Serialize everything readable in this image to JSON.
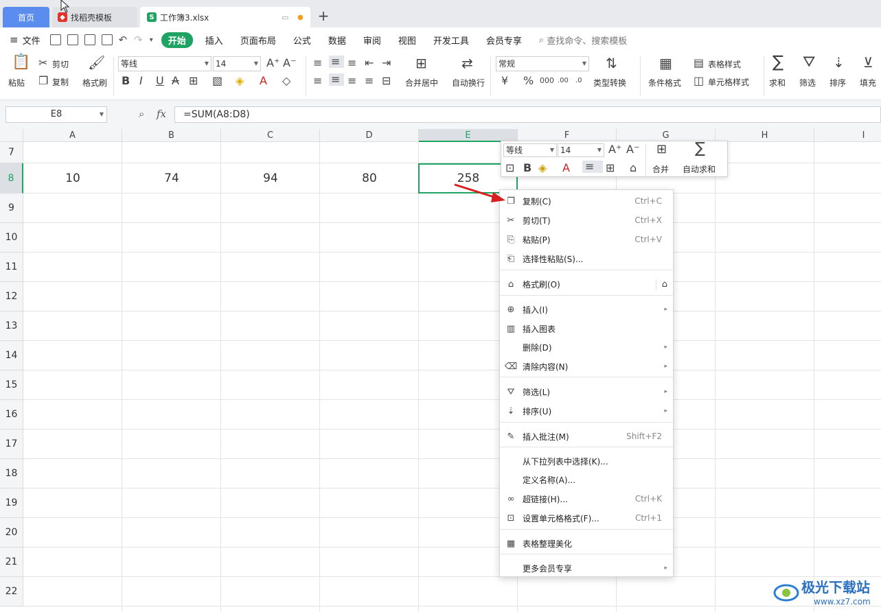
{
  "tabs": {
    "home": "首页",
    "template": "找稻壳模板",
    "workbook": "工作簿3.xlsx"
  },
  "menu": {
    "file": "文件",
    "start": "开始",
    "items": [
      "插入",
      "页面布局",
      "公式",
      "数据",
      "审阅",
      "视图",
      "开发工具",
      "会员专享"
    ],
    "search_placeholder": "查找命令、搜索模板"
  },
  "ribbon": {
    "paste": "粘贴",
    "cut": "剪切",
    "copy": "复制",
    "format_painter": "格式刷",
    "font_name": "等线",
    "font_size": "14",
    "merge_center": "合并居中",
    "wrap_text": "自动换行",
    "number_format": "常规",
    "type_convert": "类型转换",
    "conditional_format": "条件格式",
    "table_style": "表格样式",
    "cell_style": "单元格样式",
    "sum": "求和",
    "filter": "筛选",
    "sort": "排序",
    "fill": "填充"
  },
  "formula_bar": {
    "name_box": "E8",
    "fx": "fx",
    "formula": "=SUM(A8:D8)"
  },
  "grid": {
    "columns": [
      "A",
      "B",
      "C",
      "D",
      "E",
      "F",
      "G",
      "H",
      "I"
    ],
    "rows": [
      "7",
      "8",
      "9",
      "10",
      "11",
      "12",
      "13",
      "14",
      "15",
      "16",
      "17",
      "18",
      "19",
      "20",
      "21",
      "22"
    ],
    "row8": [
      "10",
      "74",
      "94",
      "80",
      "258"
    ],
    "selected_cell": "E8"
  },
  "mini_toolbar": {
    "font_name": "等线",
    "font_size": "14",
    "merge": "合并",
    "autosum": "自动求和"
  },
  "context_menu": {
    "items": [
      {
        "label": "复制(C)",
        "shortcut": "Ctrl+C",
        "icon": "copy-icon"
      },
      {
        "label": "剪切(T)",
        "shortcut": "Ctrl+X",
        "icon": "scissors-icon"
      },
      {
        "label": "粘贴(P)",
        "shortcut": "Ctrl+V",
        "icon": "paste-icon"
      },
      {
        "label": "选择性粘贴(S)...",
        "shortcut": "",
        "icon": "paste-special-icon"
      },
      {
        "label": "格式刷(O)",
        "shortcut": "",
        "icon": "format-painter-icon"
      },
      {
        "label": "插入(I)",
        "shortcut": "",
        "icon": "insert-icon"
      },
      {
        "label": "插入图表",
        "shortcut": "",
        "icon": "chart-icon"
      },
      {
        "label": "删除(D)",
        "shortcut": "",
        "icon": ""
      },
      {
        "label": "清除内容(N)",
        "shortcut": "",
        "icon": "eraser-icon"
      },
      {
        "label": "筛选(L)",
        "shortcut": "",
        "icon": "filter-icon"
      },
      {
        "label": "排序(U)",
        "shortcut": "",
        "icon": "sort-icon"
      },
      {
        "label": "插入批注(M)",
        "shortcut": "Shift+F2",
        "icon": "comment-icon"
      },
      {
        "label": "从下拉列表中选择(K)...",
        "shortcut": "",
        "icon": ""
      },
      {
        "label": "定义名称(A)...",
        "shortcut": "",
        "icon": ""
      },
      {
        "label": "超链接(H)...",
        "shortcut": "Ctrl+K",
        "icon": "link-icon"
      },
      {
        "label": "设置单元格格式(F)...",
        "shortcut": "Ctrl+1",
        "icon": "cell-format-icon"
      },
      {
        "label": "表格整理美化",
        "shortcut": "",
        "icon": "beautify-icon"
      },
      {
        "label": "更多会员专享",
        "shortcut": "",
        "icon": ""
      }
    ]
  },
  "watermark": {
    "title": "极光下载站",
    "url": "www.xz7.com"
  }
}
